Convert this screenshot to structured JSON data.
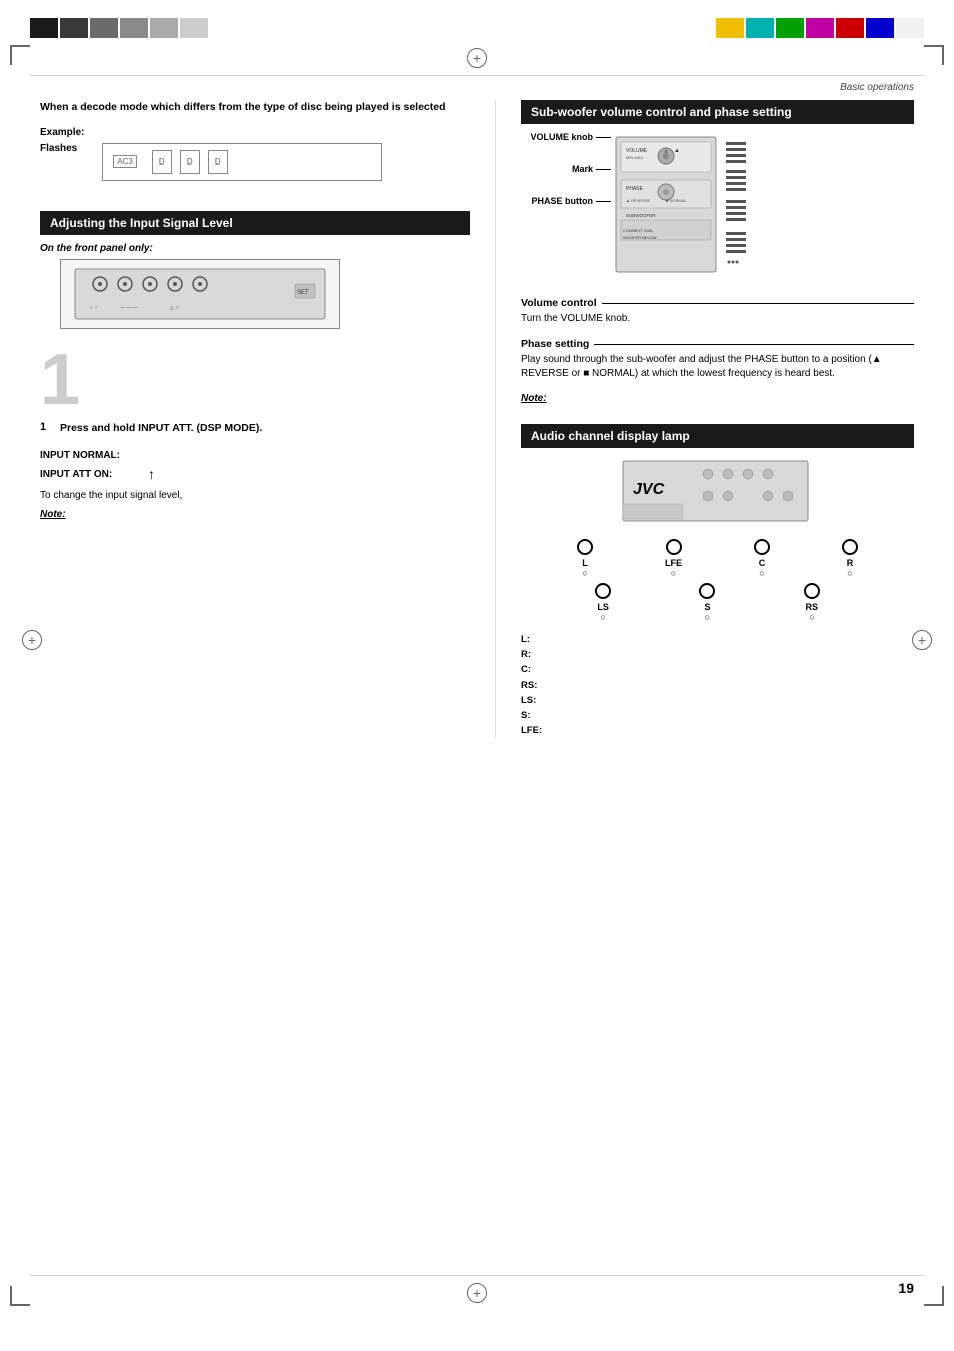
{
  "page": {
    "number": "19",
    "header": "Basic operations"
  },
  "top_bar_left": [
    "black",
    "dark",
    "gray1",
    "gray2",
    "gray3",
    "gray4"
  ],
  "top_bar_right": [
    "yellow",
    "cyan",
    "green",
    "magenta",
    "red",
    "blue",
    "white"
  ],
  "left_col": {
    "intro": {
      "text": "When a decode mode which differs from the type of disc being played is selected"
    },
    "example": {
      "label": "Example:",
      "flashes_label": "Flashes"
    },
    "adjusting_section": {
      "header": "Adjusting the Input Signal Level"
    },
    "front_panel_label": "On the front panel only:",
    "step1": {
      "number": "1",
      "instruction": "Press and hold INPUT ATT. (DSP MODE)."
    },
    "input_normal": {
      "label": "INPUT NORMAL:"
    },
    "input_att_on": {
      "label": "INPUT ATT ON:"
    },
    "change_input": {
      "text": "To change the input signal level,"
    },
    "note": {
      "label": "Note:"
    }
  },
  "right_col": {
    "subwoofer_section": {
      "header": "Sub-woofer volume control and phase setting",
      "volume_knob_label": "VOLUME knob",
      "mark_label": "Mark",
      "phase_button_label": "PHASE button"
    },
    "volume_control": {
      "title": "Volume control",
      "description": "Turn the VOLUME knob."
    },
    "phase_setting": {
      "title": "Phase setting",
      "description": "Play sound through the sub-woofer and adjust the PHASE button to a position (▲ REVERSE or ■ NORMAL) at which the lowest frequency is heard best."
    },
    "note": {
      "label": "Note:"
    },
    "audio_channel": {
      "header": "Audio channel display lamp",
      "jvc_label": "JVC",
      "channels": [
        {
          "id": "L",
          "label": "L\nO"
        },
        {
          "id": "LFE",
          "label": "LFE\nO"
        },
        {
          "id": "C",
          "label": "C\nO"
        },
        {
          "id": "R",
          "label": "R\nO"
        },
        {
          "id": "LS",
          "label": "LS\nO"
        },
        {
          "id": "S",
          "label": "S\nO"
        },
        {
          "id": "RS",
          "label": "RS\nO"
        }
      ],
      "channel_descriptions": [
        {
          "key": "L:",
          "value": ""
        },
        {
          "key": "R:",
          "value": ""
        },
        {
          "key": "C:",
          "value": ""
        },
        {
          "key": "RS:",
          "value": ""
        },
        {
          "key": "LS:",
          "value": ""
        },
        {
          "key": "S:",
          "value": ""
        },
        {
          "key": "LFE:",
          "value": ""
        }
      ]
    }
  }
}
